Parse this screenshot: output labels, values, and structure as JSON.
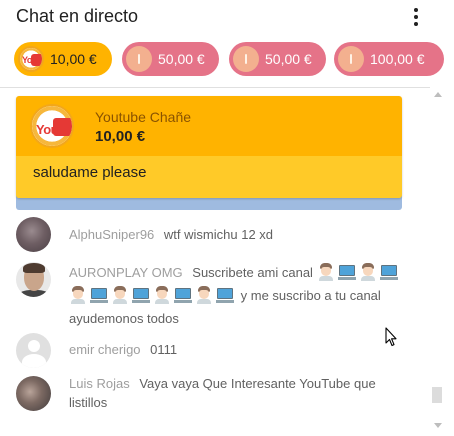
{
  "header": {
    "title": "Chat en directo",
    "menu_icon": "more-vert-icon"
  },
  "ticker": [
    {
      "amount": "10,00 €",
      "avatar": "youtube-logo-avatar",
      "color": "#ffb300"
    },
    {
      "amount": "50,00 €",
      "avatar": "default-avatar",
      "color": "#e57388"
    },
    {
      "amount": "50,00 €",
      "avatar": "default-avatar",
      "color": "#e57388"
    },
    {
      "amount": "100,00 €",
      "avatar": "default-avatar",
      "color": "#e57388"
    }
  ],
  "superchat": {
    "author": "Youtube Chañe",
    "amount": "10,00 €",
    "message": "saludame please",
    "header_color": "#ffb300",
    "body_color": "#ffca28"
  },
  "messages": [
    {
      "author": "AlphuSniper96",
      "text": "wtf wismichu 12 xd"
    },
    {
      "author": "AURONPLAY OMG",
      "text_before": "Suscribete ami canal",
      "text_after": "y me suscribo a tu canal ayudemonos todos",
      "emoji_sequence": [
        "boy",
        "computer",
        "boy",
        "computer",
        "boy",
        "computer",
        "boy",
        "computer",
        "boy",
        "computer",
        "boy",
        "computer"
      ]
    },
    {
      "author": "emir cherigo",
      "text": "0111"
    },
    {
      "author": "Luis Rojas",
      "text": "Vaya vaya Que Interesante YouTube que listillos"
    }
  ]
}
